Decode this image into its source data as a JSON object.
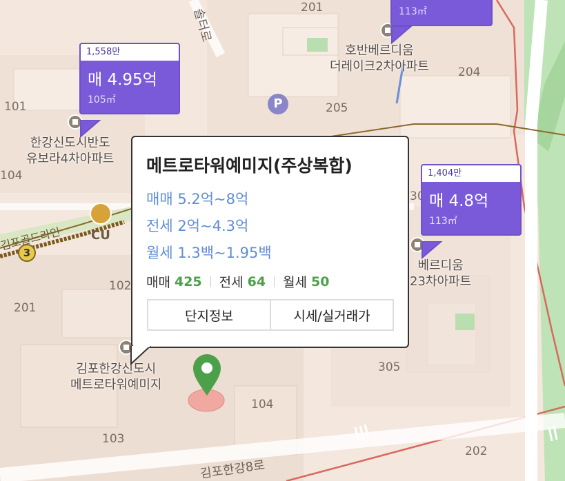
{
  "map": {
    "roads": [
      {
        "name": "솔터로"
      },
      {
        "name": "김포골드라인"
      },
      {
        "name": "김포한강8로"
      }
    ],
    "block_numbers": [
      "201",
      "101",
      "104",
      "102",
      "201",
      "103",
      "104",
      "205",
      "204",
      "305",
      "302",
      "202"
    ],
    "apartments": [
      {
        "name_line1": "한강신도시반도",
        "name_line2": "유보라4차아파트"
      },
      {
        "name_line1": "호반베르디움",
        "name_line2": "더레이크2차아파트"
      },
      {
        "name_line1": "베르디움",
        "name_line2": "23차아파트"
      },
      {
        "name_line1": "김포한강신도시",
        "name_line2": "메트로타워예미지"
      }
    ],
    "poi": {
      "cu": "CU",
      "parking": "P",
      "line_number": "3"
    }
  },
  "pins": [
    {
      "price_per_m2": "1,558만",
      "price": "매 4.95억",
      "area": "105㎡"
    },
    {
      "price_per_m2": "1,404만",
      "price": "매 4.8억",
      "area": "113㎡"
    },
    {
      "area": "113㎡"
    }
  ],
  "popup": {
    "title": "메트로타워예미지(주상복합)",
    "sale": "매매 5.2억~8억",
    "jeonse": "전세 2억~4.3억",
    "monthly": "월세 1.3백~1.95백",
    "stats": [
      {
        "label": "매매",
        "value": "425"
      },
      {
        "label": "전세",
        "value": "64"
      },
      {
        "label": "월세",
        "value": "50"
      }
    ],
    "buttons": {
      "info": "단지정보",
      "price": "시세/실거래가"
    }
  },
  "colors": {
    "pin_purple": "#7a5ad8",
    "marker_green": "#4da04a",
    "accent_blue": "#5f8dd6"
  }
}
